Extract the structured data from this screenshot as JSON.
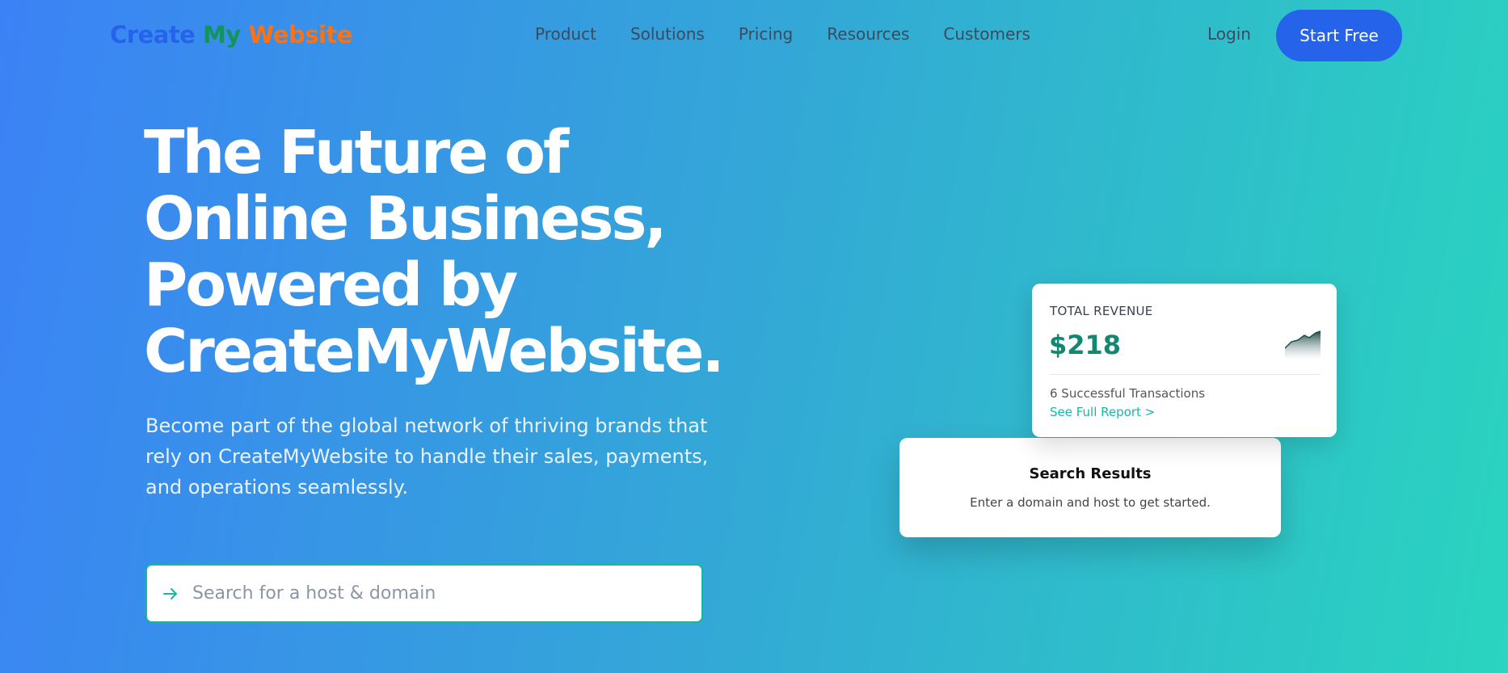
{
  "brand": {
    "word1": "Create",
    "word2": "My",
    "word3": "Website"
  },
  "nav": {
    "links": [
      "Product",
      "Solutions",
      "Pricing",
      "Resources",
      "Customers"
    ],
    "login": "Login",
    "cta": "Start Free"
  },
  "hero": {
    "title_lines": [
      "The Future of",
      "Online Business,",
      "Powered by",
      "CreateMyWebsite."
    ],
    "subtitle": "Become part of the global network of thriving brands that rely on CreateMyWebsite to handle their sales, payments, and operations seamlessly.",
    "search_placeholder": "Search for a host & domain",
    "search_icon": "arrow-right-icon"
  },
  "revenue_card": {
    "label": "TOTAL REVENUE",
    "amount": "$218",
    "transactions": "6 Successful Transactions",
    "link": "See Full Report >",
    "chart_icon": "trend-chart-icon"
  },
  "results_card": {
    "title": "Search Results",
    "text": "Enter a domain and host to get started."
  },
  "colors": {
    "primary": "#2563eb",
    "accent": "#14b8a6",
    "revenue": "#13876f",
    "brand_my": "#15935f",
    "brand_website": "#f97316"
  }
}
